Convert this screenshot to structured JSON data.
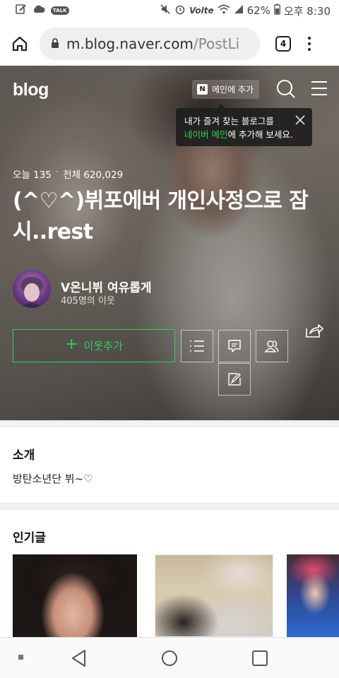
{
  "status_bar": {
    "talk_badge": "TALK",
    "battery": "62%",
    "lte": "Volte",
    "time": "오후 8:30"
  },
  "browser": {
    "url_main": "m.blog.naver.com",
    "url_rest": "/PostLi",
    "tab_count": "4"
  },
  "header": {
    "logo": "blog",
    "add_to_main": "메인에 추가",
    "n_badge": "N"
  },
  "tooltip": {
    "line1": "내가 즐겨 찾는 블로그를",
    "link": "네이버 메인",
    "line2_rest": "에 추가해 보세요."
  },
  "stats": {
    "today": "오늘 135",
    "separator": "·",
    "total": "전체 620,029"
  },
  "blog": {
    "title": "(^♡^)뷔포에버 개인사정으로 잠시..rest",
    "nickname": "V온니뷔 여유롭게",
    "neighbors": "405명의 이웃"
  },
  "actions": {
    "add_neighbor": "이웃추가",
    "plus": "+"
  },
  "intro": {
    "title": "소개",
    "text": "방탄소년단 뷔~♡"
  },
  "popular": {
    "title": "인기글"
  },
  "colors": {
    "accent_green": "#2ed25a",
    "tooltip_bg": "#1e1e1e"
  }
}
